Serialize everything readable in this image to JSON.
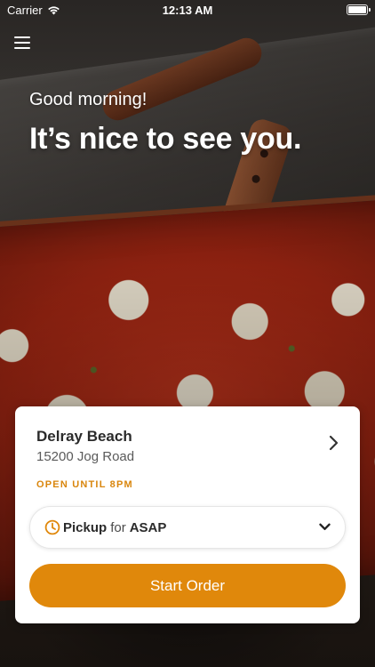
{
  "status_bar": {
    "carrier": "Carrier",
    "time": "12:13 AM",
    "wifi_icon": "wifi-icon",
    "battery_icon": "battery-icon"
  },
  "header": {
    "menu_icon": "hamburger-menu-icon"
  },
  "greeting": {
    "salutation": "Good morning!",
    "headline": "It’s nice to see you."
  },
  "location_card": {
    "store_name": "Delray Beach",
    "address": "15200 Jog Road",
    "hours": "OPEN UNTIL 8PM",
    "chevron_icon": "chevron-right-icon"
  },
  "order_mode": {
    "icon": "clock-icon",
    "mode": "Pickup",
    "connector": "for",
    "time": "ASAP",
    "dropdown_icon": "chevron-down-icon"
  },
  "actions": {
    "start_order_label": "Start Order"
  },
  "colors": {
    "accent": "#e0880b",
    "hours_text": "#d9860d",
    "card_background": "#ffffff"
  }
}
